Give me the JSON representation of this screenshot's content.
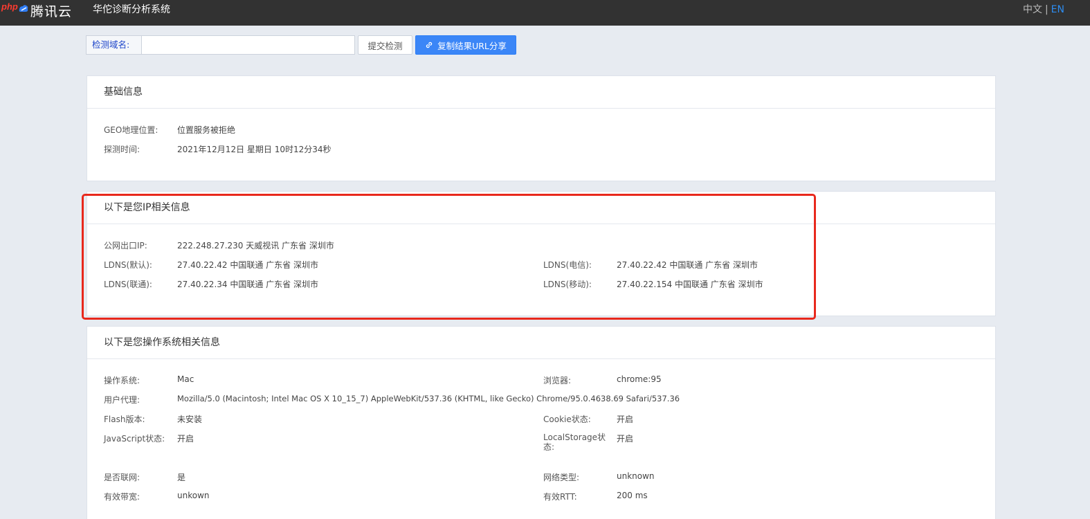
{
  "header": {
    "badge": "php",
    "brand": "腾讯云",
    "system_title": "华佗诊断分析系统",
    "lang_zh": "中文",
    "lang_sep": "|",
    "lang_en": "EN"
  },
  "search": {
    "label": "检测域名:",
    "value": "",
    "placeholder": "",
    "submit_label": "提交检测",
    "share_label": "复制结果URL分享"
  },
  "basic_info": {
    "title": "基础信息",
    "rows": [
      {
        "key": "GEO地理位置:",
        "value": "位置服务被拒绝"
      },
      {
        "key": "探测时间:",
        "value": "2021年12月12日 星期日 10时12分34秒"
      }
    ]
  },
  "ip_info": {
    "title": "以下是您IP相关信息",
    "public_ip_key": "公网出口IP:",
    "public_ip_value": "222.248.27.230 天威视讯 广东省 深圳市",
    "ldns_default_key": "LDNS(默认):",
    "ldns_default_value": "27.40.22.42 中国联通 广东省 深圳市",
    "ldns_telecom_key": "LDNS(电信):",
    "ldns_telecom_value": "27.40.22.42 中国联通 广东省 深圳市",
    "ldns_unicom_key": "LDNS(联通):",
    "ldns_unicom_value": "27.40.22.34 中国联通 广东省 深圳市",
    "ldns_mobile_key": "LDNS(移动):",
    "ldns_mobile_value": "27.40.22.154 中国联通 广东省 深圳市"
  },
  "os_info": {
    "title": "以下是您操作系统相关信息",
    "os_key": "操作系统:",
    "os_value": "Mac",
    "browser_key": "浏览器:",
    "browser_value": "chrome:95",
    "ua_key": "用户代理:",
    "ua_value": "Mozilla/5.0 (Macintosh; Intel Mac OS X 10_15_7) AppleWebKit/537.36 (KHTML, like Gecko) Chrome/95.0.4638.69 Safari/537.36",
    "flash_key": "Flash版本:",
    "flash_value": "未安装",
    "cookie_key": "Cookie状态:",
    "cookie_value": "开启",
    "js_key": "JavaScript状态:",
    "js_value": "开启",
    "localstorage_key": "LocalStorage状态:",
    "localstorage_value": "开启",
    "online_key": "是否联网:",
    "online_value": "是",
    "nettype_key": "网络类型:",
    "nettype_value": "unknown",
    "bandwidth_key": "有效带宽:",
    "bandwidth_value": "unkown",
    "rtt_key": "有效RTT:",
    "rtt_value": "200 ms"
  },
  "colors": {
    "topbar": "#323232",
    "accent": "#3b86f7",
    "highlight": "#e8281c",
    "background": "#e7ebf1"
  }
}
